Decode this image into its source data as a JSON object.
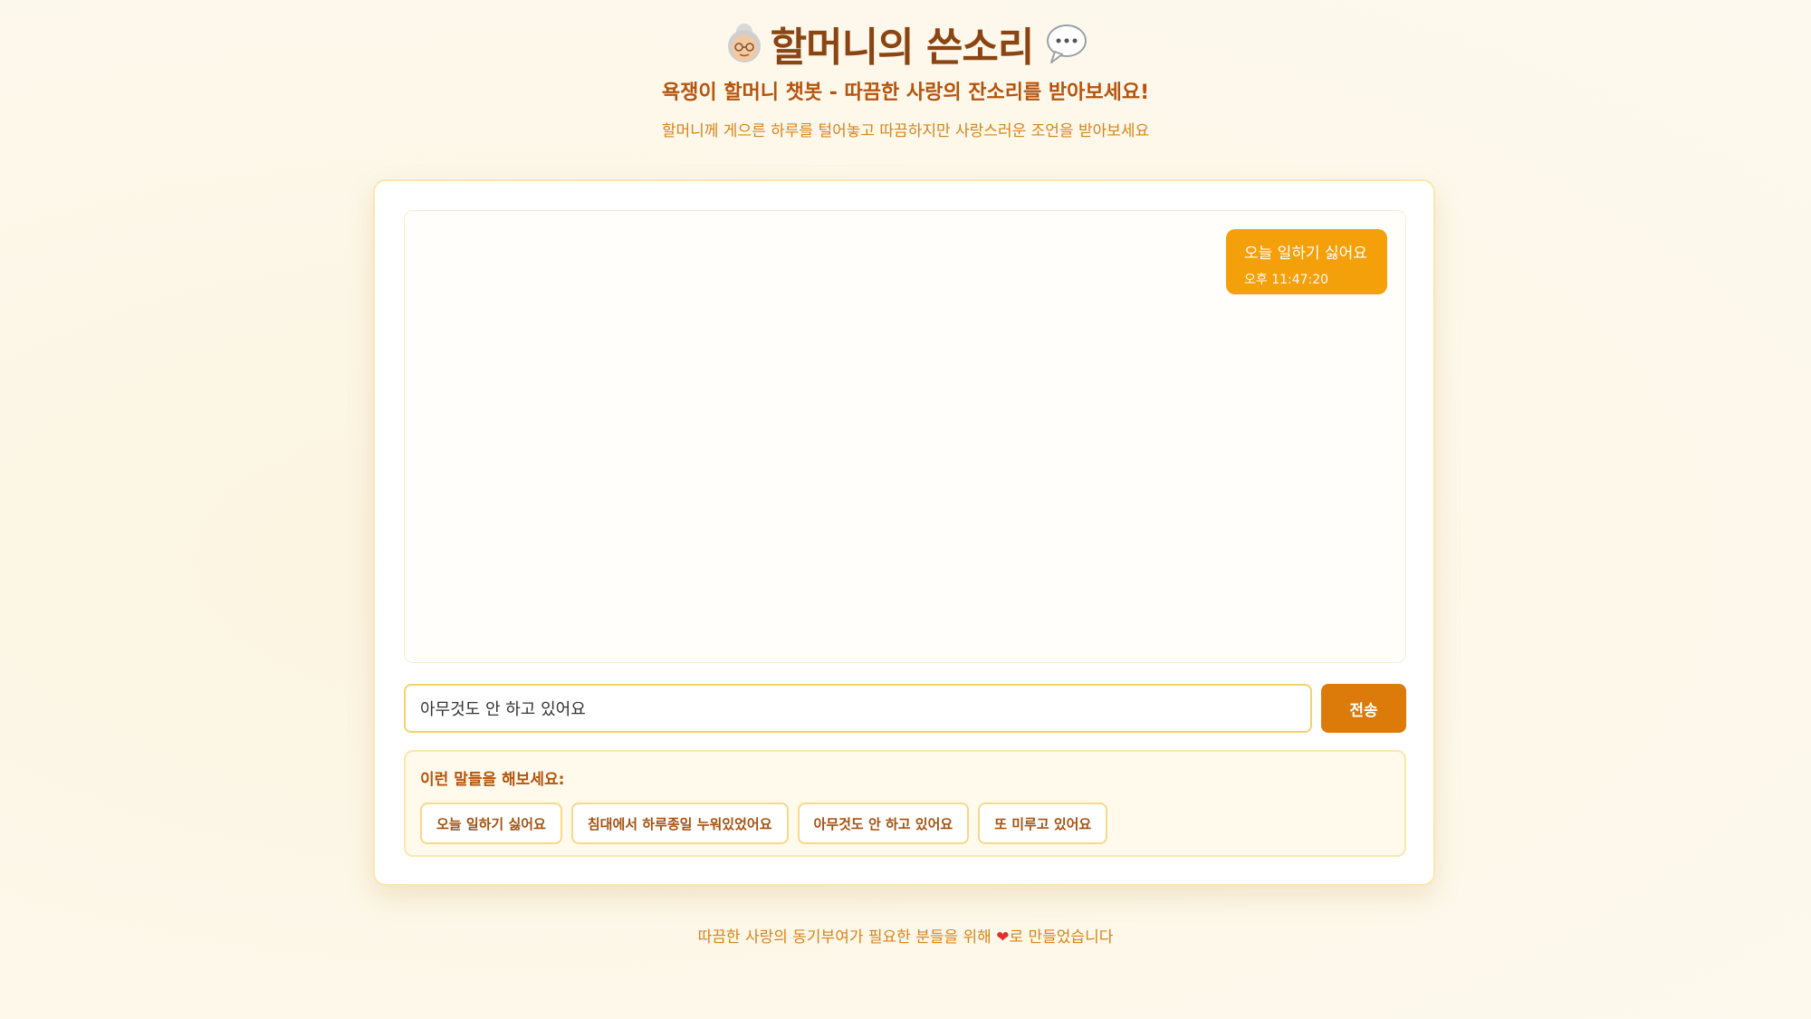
{
  "header": {
    "title": "할머니의 쓴소리",
    "subtitle": "욕쟁이 할머니 챗봇 - 따끔한 사랑의 잔소리를 받아보세요!",
    "description": "할머니께 게으른 하루를 털어놓고 따끔하지만 사랑스러운 조언을 받아보세요",
    "icons": [
      "grandma-icon",
      "speech-bubble-icon"
    ]
  },
  "chat": {
    "messages": [
      {
        "role": "user",
        "text": "오늘 일하기 싫어요",
        "time": "오후 11:47:20"
      }
    ]
  },
  "input": {
    "value": "아무것도 안 하고 있어요",
    "send_label": "전송"
  },
  "suggestions": {
    "label": "이런 말들을 해보세요:",
    "items": [
      "오늘 일하기 싫어요",
      "침대에서 하루종일 누워있었어요",
      "아무것도 안 하고 있어요",
      "또 미루고 있어요"
    ]
  },
  "footer": {
    "text_before": "따끔한 사랑의 동기부여가 필요한 분들을 위해 ",
    "heart": "❤",
    "text_after": "로 만들었습니다"
  },
  "colors": {
    "accent": "#f4a00b",
    "button": "#dc7a0a",
    "title": "#8b4513",
    "background": "#fdf7e6"
  }
}
